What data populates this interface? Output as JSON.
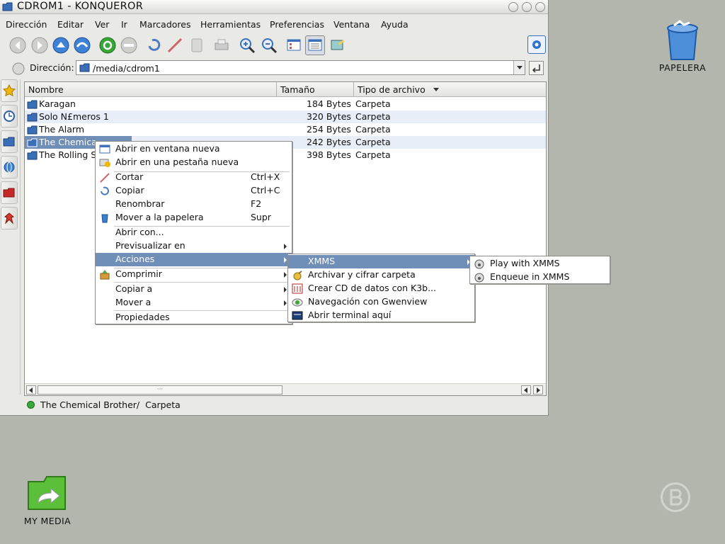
{
  "window": {
    "title": "CDROM1 - KONQUEROR"
  },
  "menubar": [
    "Dirección",
    "Editar",
    "Ver",
    "Ir",
    "Marcadores",
    "Herramientas",
    "Preferencias",
    "Ventana",
    "Ayuda"
  ],
  "address": {
    "label": "Dirección:",
    "value": "/media/cdrom1"
  },
  "table": {
    "columns": [
      "Nombre",
      "Tamaño",
      "Tipo de archivo"
    ],
    "rows": [
      {
        "name": "Karagan",
        "size": "184 Bytes",
        "type": "Carpeta"
      },
      {
        "name": "Solo N£meros 1",
        "size": "320 Bytes",
        "type": "Carpeta"
      },
      {
        "name": "The Alarm",
        "size": "254 Bytes",
        "type": "Carpeta"
      },
      {
        "name": "The Chemical Brother",
        "size": "242 Bytes",
        "type": "Carpeta"
      },
      {
        "name": "The Rolling S",
        "size": "398 Bytes",
        "type": "Carpeta"
      }
    ]
  },
  "context_menu": {
    "items": [
      "Abrir en ventana nueva",
      "Abrir en una pestaña nueva",
      "Cortar",
      "Copiar",
      "Renombrar",
      "Mover a la papelera",
      "Abrir con...",
      "Previsualizar en",
      "Acciones",
      "Comprimir",
      "Copiar a",
      "Mover a",
      "Propiedades"
    ],
    "accels": {
      "cut": "Ctrl+X",
      "copy": "Ctrl+C",
      "rename": "F2",
      "trash": "Supr"
    }
  },
  "actions_menu": {
    "items": [
      "XMMS",
      "Archivar y cifrar carpeta",
      "Crear CD de datos con K3b...",
      "Navegación con Gwenview",
      "Abrir terminal aquí"
    ]
  },
  "xmms_menu": {
    "items": [
      "Play with XMMS",
      "Enqueue in XMMS"
    ]
  },
  "status": {
    "text": "The Chemical Brother/  Carpeta"
  },
  "scroll": {
    "grip": "···"
  },
  "desktop": {
    "trash": "PAPELERA",
    "media": "MY MEDIA"
  },
  "colors": {
    "highlight": "#6f8fb8",
    "desktop": "#b2b6ad",
    "alt_row": "#e8eef7"
  }
}
